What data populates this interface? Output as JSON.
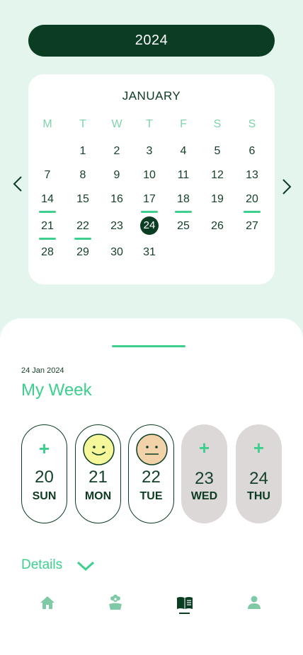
{
  "header": {
    "year": "2024"
  },
  "calendar": {
    "month": "JANUARY",
    "weekdays": [
      "M",
      "T",
      "W",
      "T",
      "F",
      "S",
      "S"
    ],
    "days": [
      "1",
      "2",
      "3",
      "4",
      "5",
      "6",
      "7",
      "8",
      "9",
      "10",
      "11",
      "12",
      "13",
      "14",
      "15",
      "16",
      "17",
      "18",
      "19",
      "20",
      "21",
      "22",
      "23",
      "24",
      "25",
      "26",
      "27",
      "28",
      "29",
      "30",
      "31"
    ],
    "today": "24",
    "marked_days": [
      "14",
      "17",
      "18",
      "20",
      "21",
      "22"
    ]
  },
  "week": {
    "date": "24 Jan 2024",
    "title": "My Week",
    "days": [
      {
        "num": "20",
        "dow": "SUN",
        "state": "add"
      },
      {
        "num": "21",
        "dow": "MON",
        "state": "happy"
      },
      {
        "num": "22",
        "dow": "TUE",
        "state": "neutral"
      },
      {
        "num": "23",
        "dow": "WED",
        "state": "future-add"
      },
      {
        "num": "24",
        "dow": "THU",
        "state": "future-add"
      }
    ],
    "plus_glyph": "+"
  },
  "details": {
    "label": "Details"
  },
  "nav": {
    "items": [
      "home-icon",
      "flower-icon",
      "journal-icon",
      "profile-icon"
    ],
    "active": "journal-icon"
  },
  "colors": {
    "dark_green": "#0b3d22",
    "accent_green": "#3ccf8e",
    "background": "#e4f5ee",
    "future_pill": "#ddd8d8",
    "happy_face": "#f5f79a",
    "neutral_face": "#f1d2a9"
  }
}
